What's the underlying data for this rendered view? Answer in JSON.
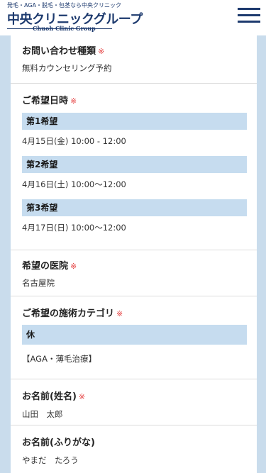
{
  "header": {
    "tagline": "発毛・AGA・脱毛・包茎なら中央クリニック",
    "logo_main": "中央クリニックグループ",
    "logo_sub": "Chuoh Clinic Group",
    "menu_icon": "hamburger-menu-icon"
  },
  "colors": {
    "brand": "#1d3a6e",
    "required": "#e53b3b",
    "subhead_bg": "#c6dcef",
    "page_bg": "#c9dcec"
  },
  "form": {
    "inquiry_type": {
      "label": "お問い合わせ種類",
      "required_mark": "※",
      "value": "無料カウンセリング予約"
    },
    "desired_datetime": {
      "label": "ご希望日時",
      "required_mark": "※",
      "choices": [
        {
          "heading": "第1希望",
          "value": "4月15日(金) 10:00 - 12:00"
        },
        {
          "heading": "第2希望",
          "value": "4月16日(土) 10:00～12:00"
        },
        {
          "heading": "第3希望",
          "value": "4月17日(日) 10:00～12:00"
        }
      ]
    },
    "clinic": {
      "label": "希望の医院",
      "required_mark": "※",
      "value": "名古屋院"
    },
    "treatment_category": {
      "label": "ご希望の施術カテゴリ",
      "required_mark": "※",
      "subheading": "休",
      "value": "【AGA・薄毛治療】"
    },
    "name": {
      "label": "お名前(姓名)",
      "required_mark": "※",
      "value": "山田　太郎"
    },
    "name_kana": {
      "label": "お名前(ふりがな)",
      "value": "やまだ　たろう"
    }
  }
}
